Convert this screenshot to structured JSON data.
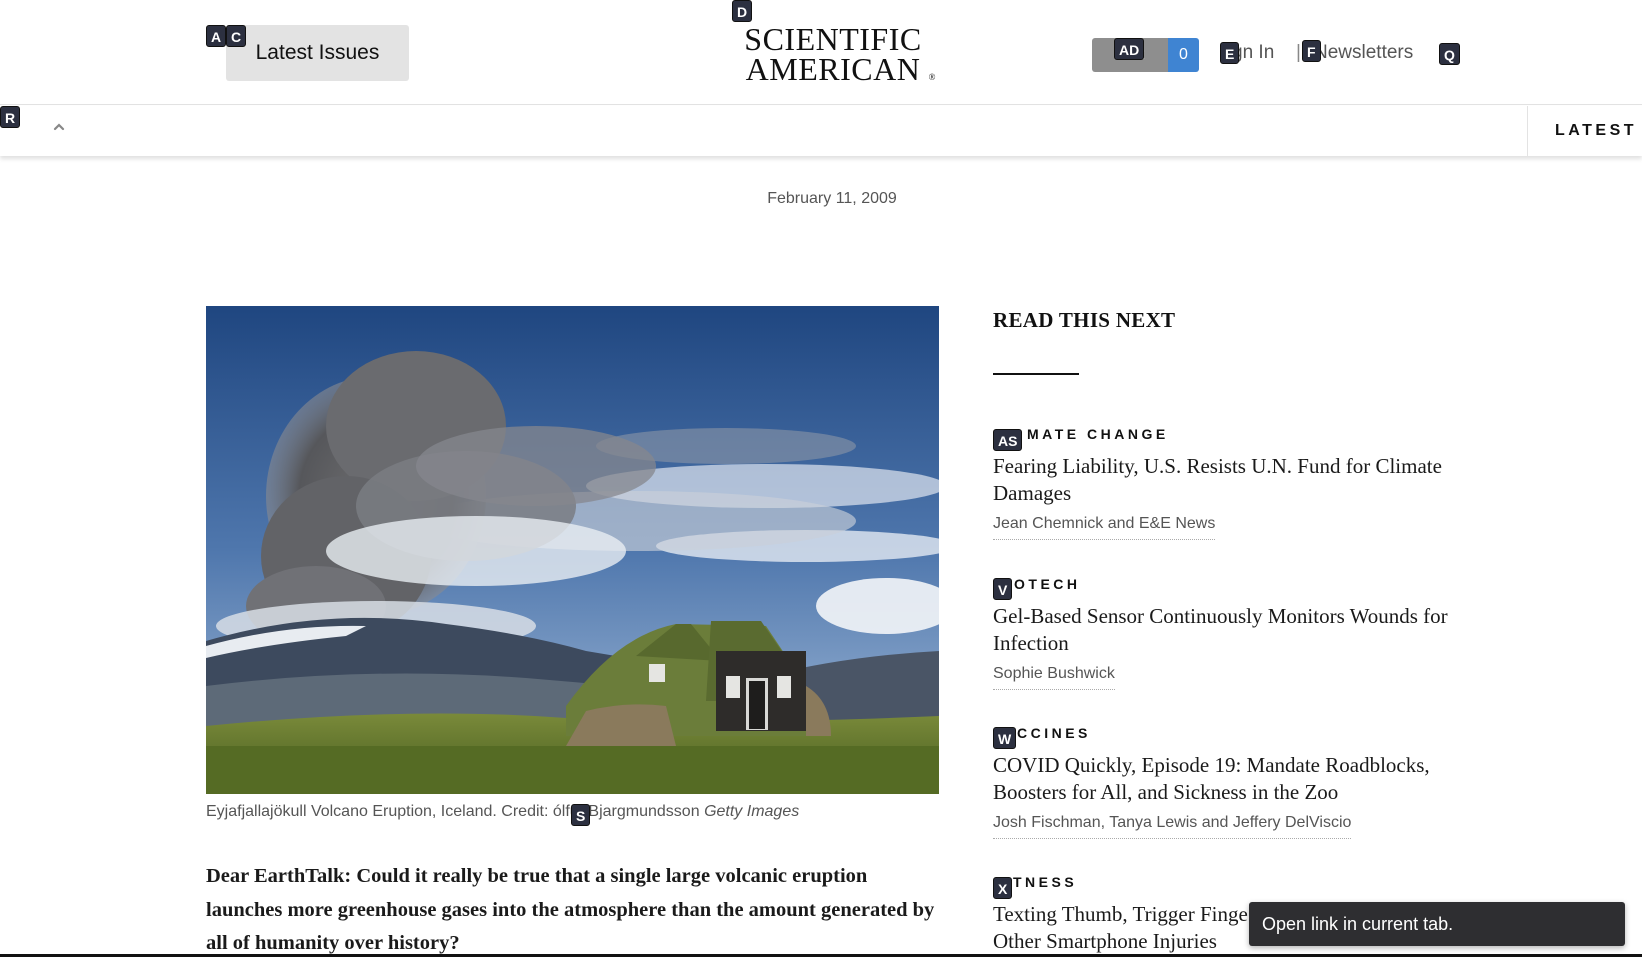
{
  "header": {
    "latest_issues_label": "Latest Issues",
    "logo_line1": "SCIENTIFIC",
    "logo_line2": "AMERICAN",
    "logo_reg": "®",
    "cart_label": "t",
    "cart_count": "0",
    "sign_in_label": "gn In",
    "separator": "|",
    "newsletters_label": "Newsletters"
  },
  "nav": {
    "chevron_icon": "chevron-up-icon",
    "latest_label": "LATEST"
  },
  "article": {
    "date": "February 11, 2009",
    "image_alt": "Eyjafjallajökull volcano eruption plume over a turf house",
    "caption_text": "Eyjafjallajökull Volcano Eruption, Iceland. Credit: ",
    "caption_credit": "ólfur Bjargmundsson",
    "caption_agency": "Getty Images",
    "lede": "Dear EarthTalk: Could it really be true that a single large volcanic eruption launches more greenhouse gases into the atmosphere than the amount generated by all of humanity over history?"
  },
  "sidebar": {
    "title": "READ THIS NEXT",
    "stories": [
      {
        "category": "MATE CHANGE",
        "title": "Fearing Liability, U.S. Resists U.N. Fund for Climate Damages",
        "author": "Jean Chemnick and E&E News"
      },
      {
        "category": "OTECH",
        "title": "Gel-Based Sensor Continuously Monitors Wounds for Infection",
        "author": "Sophie Bushwick"
      },
      {
        "category": "CCINES",
        "title": "COVID Quickly, Episode 19: Mandate Roadblocks, Boosters for All, and Sickness in the Zoo",
        "author": "Josh Fischman, Tanya Lewis and Jeffery DelViscio"
      },
      {
        "category": "TNESS",
        "title": "Texting Thumb, Trigger Finge",
        "title_line2": "Other Smartphone Injuries"
      }
    ]
  },
  "tooltip": {
    "text": "Open link in current tab."
  },
  "hints": {
    "ac": "A",
    "ac2": "C",
    "d": "D",
    "ad": "AD",
    "e": "E",
    "f": "F",
    "q": "Q",
    "r": "R",
    "s": "S",
    "as": "AS",
    "v": "V",
    "w": "W",
    "x": "X"
  },
  "colors": {
    "accent_blue": "#3f84d2",
    "hint_bg": "#2c3040",
    "tooltip_bg": "#2e2e31"
  }
}
